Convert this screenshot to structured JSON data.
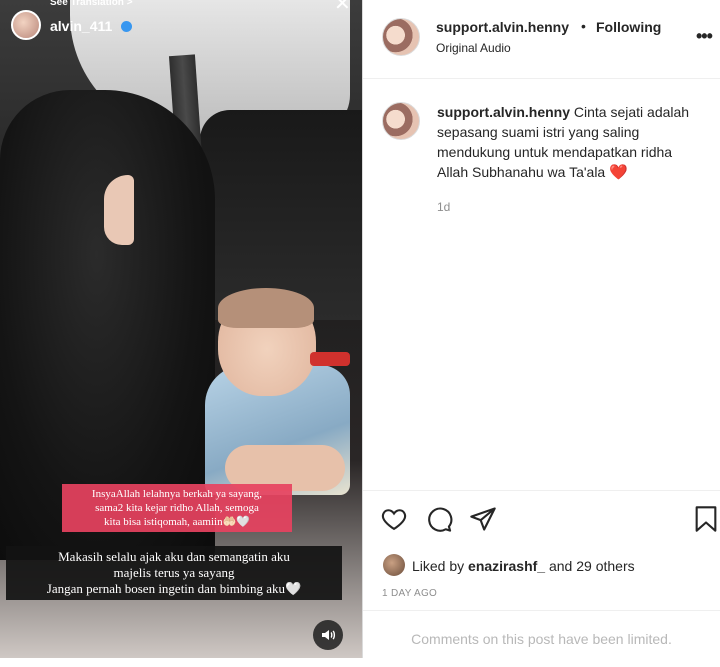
{
  "story": {
    "see_translation": "See Translation >",
    "username": "alvin_411",
    "close_glyph": "✕",
    "pink_caption": [
      "InsyaAllah lelahnya berkah ya sayang,",
      "sama2 kita kejar ridho Allah, semoga",
      "kita bisa istiqomah, aamiin🤲🏻🤍"
    ],
    "dark_caption": [
      "Makasih selalu ajak aku dan semangatin aku",
      "majelis terus ya sayang",
      "Jangan pernah bosen ingetin dan bimbing aku🤍"
    ],
    "sound_icon": "speaker-icon"
  },
  "header": {
    "username": "support.alvin.henny",
    "dot": "•",
    "follow_status": "Following",
    "audio": "Original Audio",
    "more_glyph": "•••"
  },
  "caption": {
    "username": "support.alvin.henny",
    "text": "Cinta sejati adalah sepasang suami istri yang saling mendukung untuk mendapatkan ridha Allah Subhanahu wa Ta'ala",
    "emoji": "❤️",
    "time": "1d"
  },
  "actions": {
    "icons": [
      "heart-icon",
      "comment-icon",
      "share-icon",
      "bookmark-icon"
    ],
    "likes_prefix": "Liked by ",
    "likes_user": "enazirashf_",
    "likes_suffix": " and 29 others",
    "date": "1 DAY AGO"
  },
  "comments_limited": "Comments on this post have been limited.",
  "colors": {
    "verified": "#3897f0",
    "pink_caption_bg": "#e74260",
    "heart": "#e0243a"
  }
}
